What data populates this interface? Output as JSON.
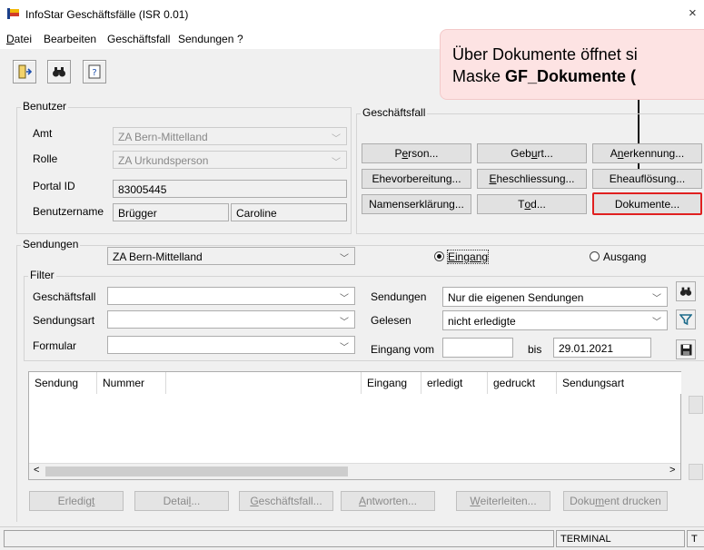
{
  "window": {
    "title": "InfoStar Geschäftsfälle (ISR 0.01)",
    "close_glyph": "×",
    "icon": "app-flag-icon"
  },
  "menu": {
    "items": [
      {
        "label": "Datei",
        "mnemonic": "D"
      },
      {
        "label": "Bearbeiten"
      },
      {
        "label": "Geschäftsfall"
      },
      {
        "label": "Sendungen"
      },
      {
        "label": "?"
      }
    ]
  },
  "toolbar": {
    "icons": [
      "exit-door-icon",
      "binoculars-icon",
      "help-book-icon"
    ]
  },
  "callout": {
    "line1": "Über Dokumente öffnet si",
    "line2_prefix": "Maske ",
    "line2_bold": "GF_Dokumente (",
    "accent": "#e02020"
  },
  "benutzer": {
    "group_label": "Benutzer",
    "amt_label": "Amt",
    "amt_value": "ZA Bern-Mittelland",
    "rolle_label": "Rolle",
    "rolle_value": "ZA Urkundsperson",
    "portal_label": "Portal ID",
    "portal_value": "83005445",
    "benutzername_label": "Benutzername",
    "nachname": "Brügger",
    "vorname": "Caroline"
  },
  "geschaeftsfall": {
    "group_label": "Geschäftsfall",
    "buttons": [
      {
        "name": "person-button",
        "text": "Person...",
        "u": "e"
      },
      {
        "name": "geburt-button",
        "text": "Geburt...",
        "u": "u"
      },
      {
        "name": "anerkennung-button",
        "text": "Anerkennung...",
        "u": "n"
      },
      {
        "name": "ehevorbereitung-button",
        "text": "Ehevorbereitung..."
      },
      {
        "name": "eheschliessung-button",
        "text": "Eheschliessung...",
        "u": "E"
      },
      {
        "name": "eheaufloesung-button",
        "text": "Eheauflösung..."
      },
      {
        "name": "namenserklaerung-button",
        "text": "Namenserklärung..."
      },
      {
        "name": "tod-button",
        "text": "Tod...",
        "u": "o"
      },
      {
        "name": "dokumente-button",
        "text": "Dokumente..."
      }
    ]
  },
  "sendungen": {
    "group_label": "Sendungen",
    "amt_value": "ZA Bern-Mittelland",
    "radio_eingang": "Eingang",
    "radio_ausgang": "Ausgang",
    "filter_label": "Filter",
    "geschaeftsfall_label": "Geschäftsfall",
    "sendungsart_label": "Sendungsart",
    "formular_label": "Formular",
    "sendungen_label": "Sendungen",
    "sendungen_value": "Nur die eigenen Sendungen",
    "gelesen_label": "Gelesen",
    "gelesen_value": "nicht erledigte",
    "eingang_vom_label": "Eingang vom",
    "eingang_vom_value": "",
    "bis_label": "bis",
    "bis_value": "29.01.2021"
  },
  "table": {
    "columns": [
      "Sendung",
      "Nummer",
      "",
      "Eingang",
      "erledigt",
      "gedruckt",
      "Sendungsart"
    ]
  },
  "bottom_buttons": [
    {
      "name": "erledigt-button",
      "text": "Erledigt"
    },
    {
      "name": "detail-button",
      "text": "Detail..."
    },
    {
      "name": "geschaeftsfall-button",
      "text": "Geschäftsfall..."
    },
    {
      "name": "antworten-button",
      "text": "Antworten..."
    },
    {
      "name": "weiterleiten-button",
      "text": "Weiterleiten..."
    },
    {
      "name": "dokument-drucken-button",
      "text": "Dokument drucken"
    }
  ],
  "status": {
    "terminal": "TERMINAL",
    "extra": "T"
  }
}
